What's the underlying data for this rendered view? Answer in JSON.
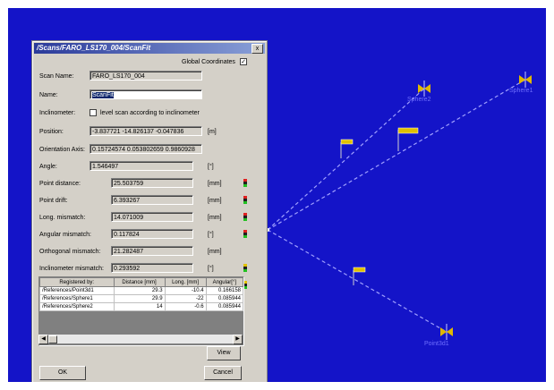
{
  "dialog": {
    "title": "/Scans/FARO_LS170_004/ScanFit",
    "close_label": "x",
    "global_coordinates_label": "Global Coordinates",
    "global_coordinates_checked": true,
    "scan_name_label": "Scan Name:",
    "scan_name_value": "FARO_LS170_004",
    "name_label": "Name:",
    "name_value": "ScanFit",
    "inclinometer_label": "Inclinometer:",
    "inclinometer_option": "level scan according to inclinometer",
    "position_label": "Position:",
    "position_value": "-3.837721 -14.826137 -0.047836",
    "position_unit": "[m]",
    "orientation_label": "Orientation Axis:",
    "orientation_value": "0.15724574 0.053802659 0.9860928",
    "angle_label": "Angle:",
    "angle_value": "1.546497",
    "angle_unit": "[°]",
    "metrics": [
      {
        "label": "Point distance:",
        "value": "25.503759",
        "unit": "[mm]"
      },
      {
        "label": "Point drift:",
        "value": "6.393267",
        "unit": "[mm]"
      },
      {
        "label": "Long. mismatch:",
        "value": "14.071009",
        "unit": "[mm]"
      },
      {
        "label": "Angular mismatch:",
        "value": "0.117824",
        "unit": "[°]"
      },
      {
        "label": "Orthogonal mismatch:",
        "value": "21.282487",
        "unit": "[mm]"
      },
      {
        "label": "Inclinometer mismatch:",
        "value": "0.293592",
        "unit": "[°]"
      }
    ],
    "table": {
      "headers": [
        "Registered by:",
        "Distance [mm]",
        "Long. [mm]",
        "Angular[°]"
      ],
      "rows": [
        [
          "/References/Point3d1",
          "29.3",
          "-10.4",
          "0.166158"
        ],
        [
          "/References/Sphere1",
          "29.9",
          "-22",
          "0.085944"
        ],
        [
          "/References/Sphere2",
          "14",
          "-0.6",
          "0.085944"
        ]
      ]
    },
    "view_button": "View",
    "ok_button": "OK",
    "cancel_button": "Cancel"
  },
  "scene": {
    "background_color": "#1414c8",
    "labels": [
      "Sphere2",
      "Sphere1",
      "Point3d1"
    ]
  }
}
